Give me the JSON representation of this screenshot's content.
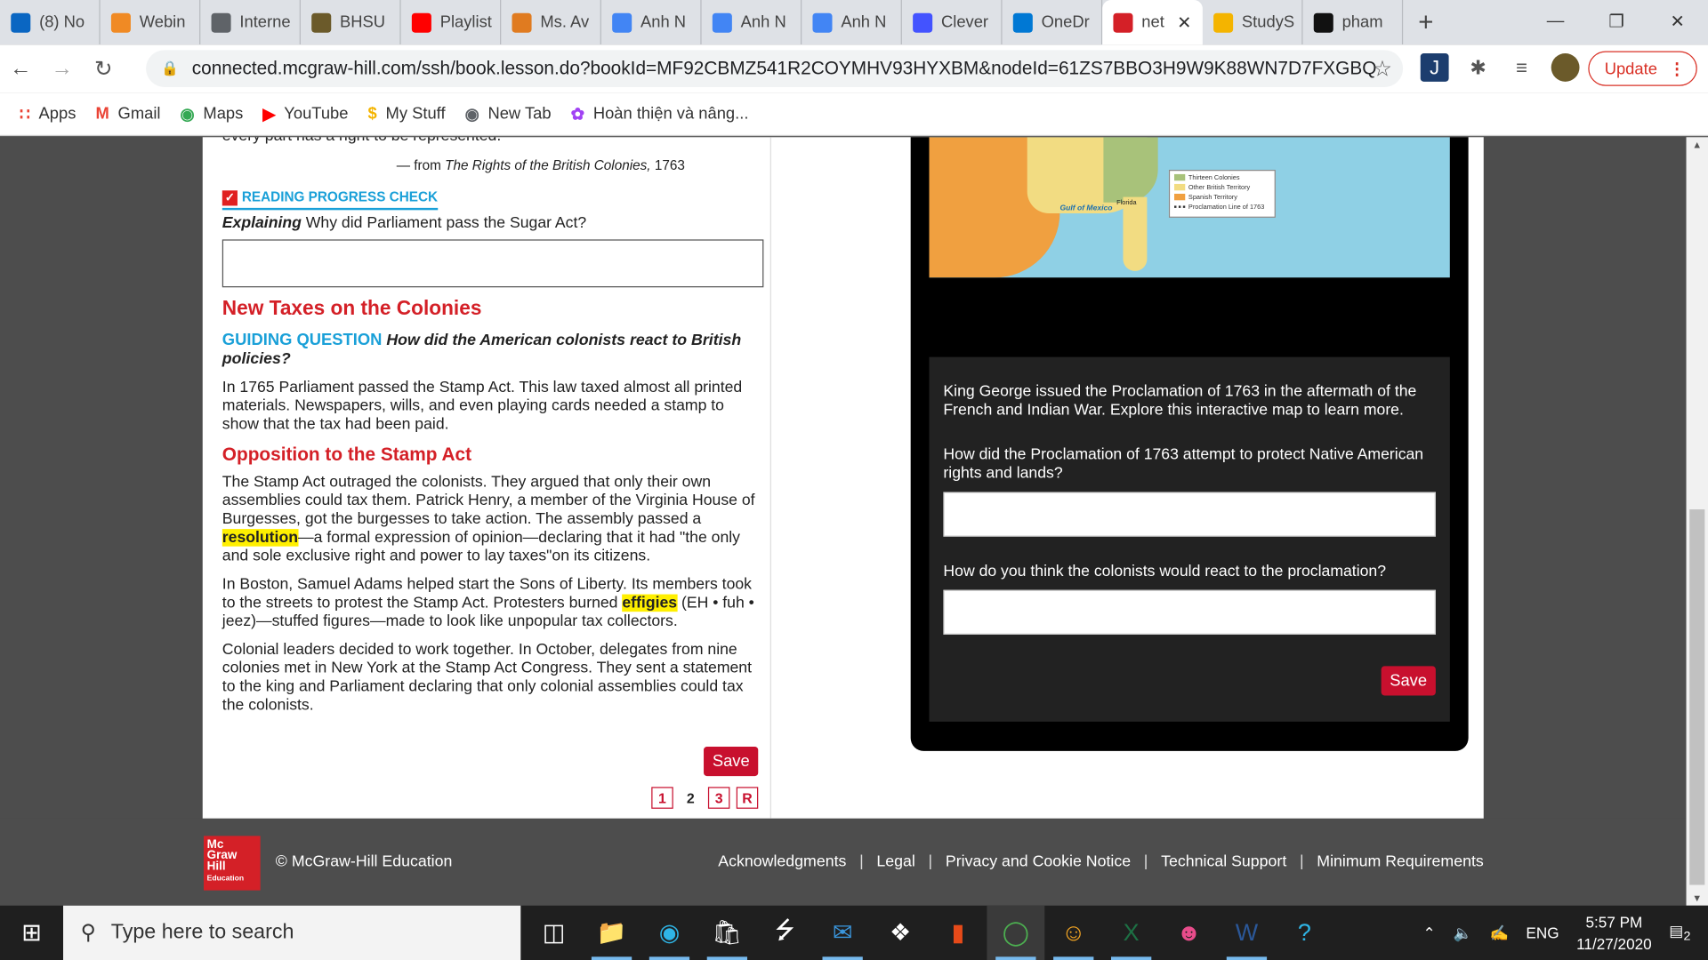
{
  "browser": {
    "tabs": [
      {
        "label": "(8) No",
        "color": "#0a66c2"
      },
      {
        "label": "Webin",
        "color": "#f08a24"
      },
      {
        "label": "Interne",
        "color": "#5f6368"
      },
      {
        "label": "BHSU",
        "color": "#6b5a2a"
      },
      {
        "label": "Playlist",
        "color": "#ff0000"
      },
      {
        "label": "Ms. Av",
        "color": "#e07b20"
      },
      {
        "label": "Anh N",
        "color": "#4285f4"
      },
      {
        "label": "Anh N",
        "color": "#4285f4"
      },
      {
        "label": "Anh N",
        "color": "#4285f4"
      },
      {
        "label": "Clever",
        "color": "#4353ff"
      },
      {
        "label": "OneDr",
        "color": "#0078d4"
      },
      {
        "label": "net",
        "color": "#d42027",
        "active": true
      },
      {
        "label": "StudyS",
        "color": "#f4b400"
      },
      {
        "label": "pham",
        "color": "#111111"
      }
    ],
    "url": "connected.mcgraw-hill.com/ssh/book.lesson.do?bookId=MF92CBMZ541R2COYMHV93HYXBM&nodeId=61ZS7BBO3H9W9K88WN7D7FXGBQ",
    "update_label": "Update",
    "bookmarks": [
      "Apps",
      "Gmail",
      "Maps",
      "YouTube",
      "My Stuff",
      "New Tab",
      "Hoàn thiện và nâng..."
    ]
  },
  "lesson": {
    "cut_line": "every part has a right to be represented.",
    "source_prefix": "— from ",
    "source_title": "The Rights of the British Colonies,",
    "source_year": " 1763",
    "rpc_label": "READING PROGRESS CHECK",
    "q_label": "Explaining",
    "q_text": " Why did Parliament pass the Sugar Act?",
    "h_new_taxes": "New Taxes on the Colonies",
    "gq_label": "GUIDING QUESTION",
    "gq_text": " How did the American colonists react to British policies?",
    "p1": "In 1765 Parliament passed the Stamp Act. This law taxed almost all printed materials. Newspapers, wills, and even playing cards needed a stamp to show that the tax had been paid.",
    "h_opposition": "Opposition to the Stamp Act",
    "p2a": "The Stamp Act outraged the colonists. They argued that only their own assemblies could tax them. Patrick Henry, a member of the Virginia House of Burgesses, got the burgesses to take action. The assembly passed a ",
    "p2_hl": "resolution",
    "p2b": "—a formal expression of opinion—declaring that it had \"the only and sole exclusive right and power to lay taxes\"on its citizens.",
    "p3a": "In Boston, Samuel Adams helped start the Sons of Liberty. Its members took to the streets to protest the Stamp Act. Protesters burned ",
    "p3_hl": "effigies",
    "p3b": " (EH • fuh • jeez)—stuffed figures—made to look like unpopular tax collectors.",
    "p4": "Colonial leaders decided to work together. In October, delegates from nine colonies met in New York at the Stamp Act Congress. They sent a statement to the king and Parliament declaring that only colonial assemblies could tax the colonists.",
    "save_label": "Save",
    "pages": [
      "1",
      "2",
      "3",
      "R"
    ],
    "current_page": "2"
  },
  "map": {
    "legend": [
      "Thirteen Colonies",
      "Other British Territory",
      "Spanish Territory",
      "Proclamation Line of 1763"
    ],
    "label_gulf": "Gulf of Mexico",
    "label_florida": "Florida",
    "colors": {
      "thirteen": "#a8c27a",
      "british": "#f2dc82",
      "spanish": "#f0a040",
      "water": "#8fd0e5"
    }
  },
  "activity": {
    "intro": "King George issued the Proclamation of 1763 in the aftermath of the French and Indian War. Explore this interactive map to learn more.",
    "q1": "How did the Proclamation of 1763 attempt to protect Native American rights and lands?",
    "q2": "How do you think the colonists would react to the proclamation?",
    "save_label": "Save"
  },
  "footer": {
    "logo": "Mc Graw Hill Education",
    "copyright": "© McGraw-Hill Education",
    "links": [
      "Acknowledgments",
      "Legal",
      "Privacy and Cookie Notice",
      "Technical Support",
      "Minimum Requirements"
    ]
  },
  "taskbar": {
    "search_placeholder": "Type here to search",
    "lang": "ENG",
    "time": "5:57 PM",
    "date": "11/27/2020",
    "notifications": "2"
  },
  "accent": "#c8102e"
}
